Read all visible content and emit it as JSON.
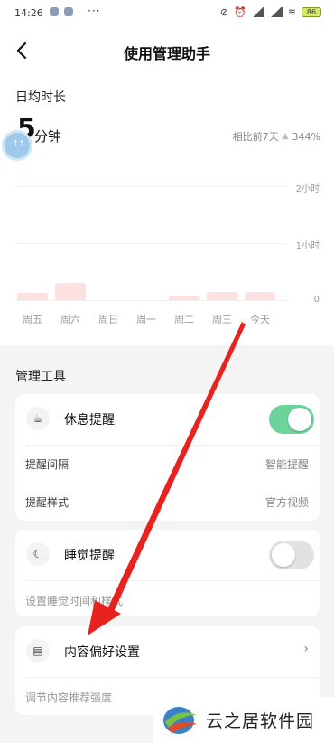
{
  "status_bar": {
    "time": "14:26",
    "more": "···",
    "battery": "86"
  },
  "nav": {
    "title": "使用管理助手"
  },
  "summary": {
    "label": "日均时长",
    "value": "5",
    "unit": "分钟",
    "compare_label": "相比前7天",
    "compare_value": "344%"
  },
  "chart_data": {
    "type": "bar",
    "categories": [
      "周五",
      "周六",
      "周日",
      "周一",
      "周二",
      "周三",
      "今天"
    ],
    "values": [
      8,
      18,
      0,
      0,
      5,
      9,
      9
    ],
    "y_ticks": [
      "2小时",
      "1小时",
      "0"
    ],
    "ylim": [
      0,
      120
    ],
    "colors": {
      "bar": "#fde0e0"
    }
  },
  "tools": {
    "title": "管理工具",
    "rest": {
      "label": "休息提醒",
      "enabled": true,
      "interval_label": "提醒间隔",
      "interval_value": "智能提醒",
      "style_label": "提醒样式",
      "style_value": "官方视频"
    },
    "sleep": {
      "label": "睡觉提醒",
      "enabled": false,
      "hint": "设置睡觉时间和样式"
    },
    "content": {
      "label": "内容偏好设置",
      "hint": "调节内容推荐强度"
    }
  },
  "watermark": {
    "text": "云之居软件园"
  },
  "colors": {
    "toggle_on": "#6cd39a",
    "arrow": "#e8231f"
  }
}
